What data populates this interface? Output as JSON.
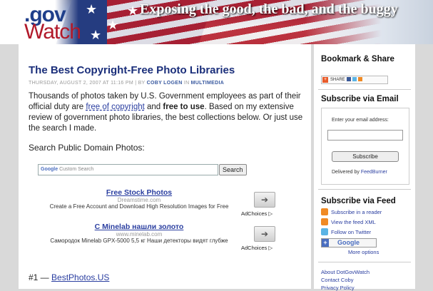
{
  "header": {
    "logo_gov": ".gov",
    "logo_watch": "Watch",
    "tagline": "Exposing the good, the bad, and the buggy"
  },
  "post": {
    "title": "The Best Copyright-Free Photo Libraries",
    "meta_date": "THURSDAY, AUGUST 2, 2007 AT 11:16 PM | BY ",
    "meta_author": "COBY LOGEN",
    "meta_in": " IN ",
    "meta_category": "MULTIMEDIA",
    "intro_1": "Thousands of photos taken by U.S. Government employees as part of their official duty are ",
    "intro_link": "free of copyright",
    "intro_2": " and ",
    "intro_bold": "free to use",
    "intro_3": ". Based on my extensive review of government photo libraries, the best collections below. Or just use the search I made.",
    "search_heading": "Search Public Domain Photos:",
    "search_placeholder_google": "Google",
    "search_placeholder_text": " Custom Search",
    "search_button": "Search",
    "first_item_prefix": "#1 — ",
    "first_item_link": "BestPhotos.US"
  },
  "ads": [
    {
      "title": "Free Stock Photos",
      "url": "Dreamstime.com",
      "desc": "Create a Free Account and Download High Resolution Images for Free",
      "arrow": "➔",
      "adchoices": "AdChoices ▷"
    },
    {
      "title": "С Minelab нашли золото",
      "url": "www.minelab.com",
      "desc": "Самородок Minelab GPX-5000 5,5 кг Наши детекторы видят глубже",
      "arrow": "➔",
      "adchoices": "AdChoices ▷"
    }
  ],
  "sidebar": {
    "bookmark_heading": "Bookmark & Share",
    "share_label": "SHARE",
    "email_heading": "Subscribe via Email",
    "email_label": "Enter your email address:",
    "subscribe_button": "Subscribe",
    "delivered_by": "Delivered by ",
    "feedburner": "FeedBurner",
    "feed_heading": "Subscribe via Feed",
    "feed_items": [
      {
        "label": "Subscribe in a reader",
        "icon": "rss-icon"
      },
      {
        "label": "View the feed XML",
        "icon": "rss-icon"
      },
      {
        "label": "Follow on Twitter",
        "icon": "twitter-icon"
      }
    ],
    "google_add": "Google",
    "more_options": "More options",
    "links": [
      "About DotGovWatch",
      "Contact Coby",
      "Privacy Policy"
    ]
  },
  "colors": {
    "title_blue": "#1a2e7a",
    "link_blue": "#2a3ea0",
    "logo_red": "#b1192a"
  }
}
